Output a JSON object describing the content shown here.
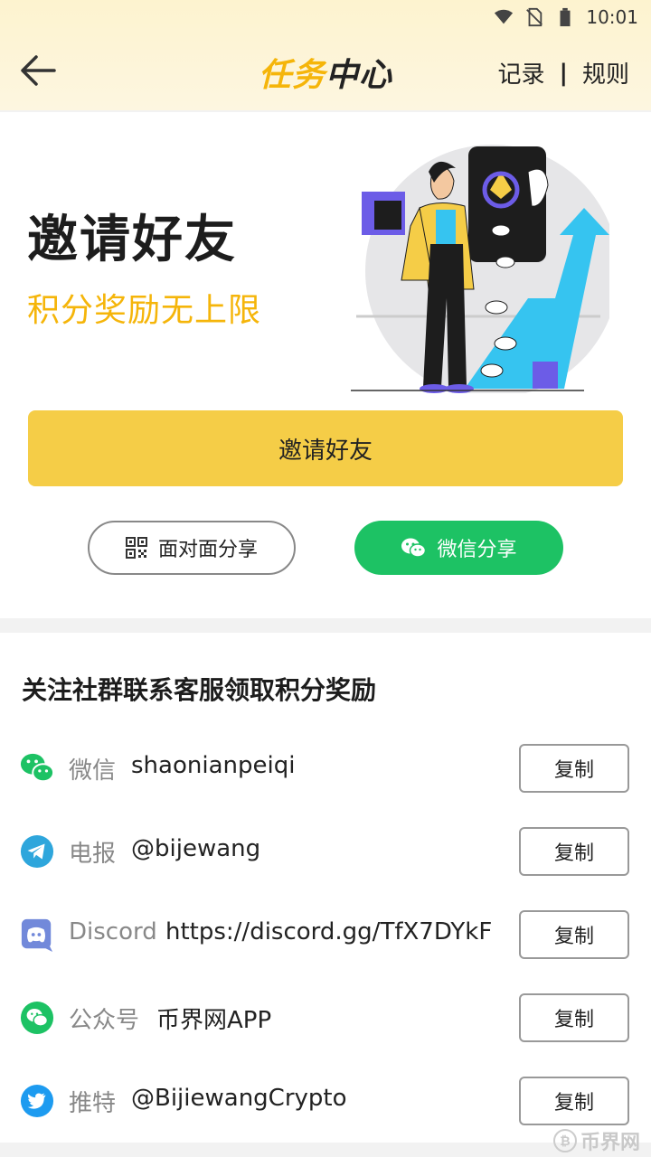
{
  "status_bar": {
    "time": "10:01",
    "icons": [
      "wifi-icon",
      "no-sim-icon",
      "battery-icon"
    ]
  },
  "header": {
    "title_part1": "任务",
    "title_part2": "中心",
    "link_records": "记录",
    "separator": "|",
    "link_rules": "规则"
  },
  "invite": {
    "title": "邀请好友",
    "subtitle": "积分奖励无上限",
    "button_label": "邀请好友",
    "face_to_face_label": "面对面分享",
    "wechat_share_label": "微信分享"
  },
  "community": {
    "title": "关注社群联系客服领取积分奖励",
    "copy_label": "复制",
    "rows": [
      {
        "icon": "wechat-icon",
        "label": "微信",
        "value": "shaonianpeiqi"
      },
      {
        "icon": "telegram-icon",
        "label": "电报",
        "value": "@bijewang"
      },
      {
        "icon": "discord-icon",
        "label": "Discord",
        "value": "https://discord.gg/TfX7DYkF"
      },
      {
        "icon": "wechat-official-icon",
        "label": "公众号",
        "value": "币界网APP"
      },
      {
        "icon": "twitter-icon",
        "label": "推特",
        "value": "@BijiewangCrypto"
      }
    ]
  },
  "watermark": {
    "text": "币界网"
  },
  "colors": {
    "accent_yellow": "#f5cd47",
    "brand_yellow": "#f5b50a",
    "wechat_green": "#1dc264"
  }
}
